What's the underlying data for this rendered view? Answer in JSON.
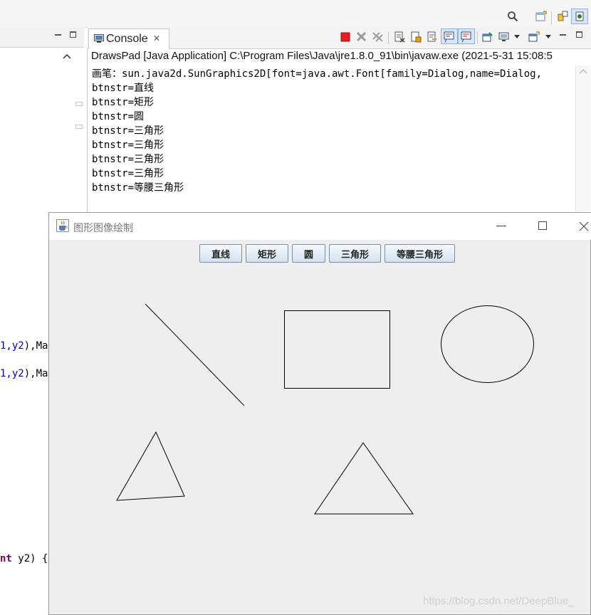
{
  "console": {
    "tab_label": "Console",
    "close_glyph": "✕",
    "description": "DrawsPad [Java Application] C:\\Program Files\\Java\\jre1.8.0_91\\bin\\javaw.exe  (2021-5-31 15:08:5",
    "lines": [
      "画笔：sun.java2d.SunGraphics2D[font=java.awt.Font[family=Dialog,name=Dialog,",
      "btnstr=直线",
      "btnstr=矩形",
      "btnstr=圆",
      "btnstr=三角形",
      "btnstr=三角形",
      "btnstr=三角形",
      "btnstr=三角形",
      "btnstr=等腰三角形"
    ]
  },
  "editor": {
    "frag1_var": "1,y2",
    "frag1_rest": "),Ma",
    "frag2_var": "1,y2",
    "frag2_rest": "),Ma",
    "frag3_kw": "nt",
    "frag3_rest": " y2) {"
  },
  "frame": {
    "title": "图形图像绘制",
    "buttons": [
      "直线",
      "矩形",
      "圆",
      "三角形",
      "等腰三角形"
    ]
  },
  "icons": {
    "search": "search-icon",
    "stop": "terminate-icon",
    "remove": "remove-launch-icon",
    "clear": "clear-console-icon",
    "pin": "pin-console-icon",
    "minimize": "minimize-icon",
    "maximize": "maximize-icon",
    "java": "java-cup-icon"
  },
  "watermark": "https://blog.csdn.net/DeepBlue_"
}
